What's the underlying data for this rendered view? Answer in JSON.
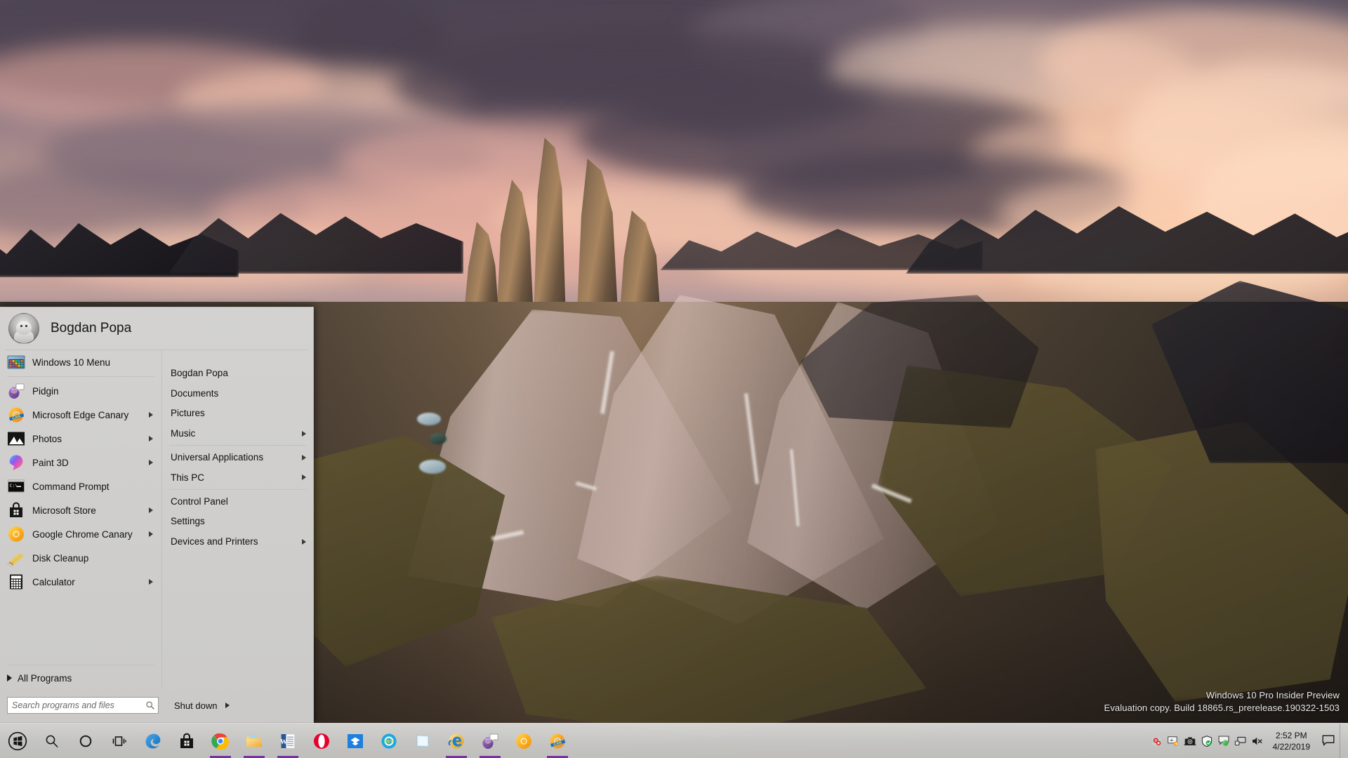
{
  "desktop": {
    "wallpaper_description": "Tre Cime di Lavaredo dolomite peaks at sunset with pink and orange clouds",
    "watermark": {
      "line1": "Windows 10 Pro Insider Preview",
      "line2": "Evaluation copy. Build 18865.rs_prerelease.190322-1503"
    }
  },
  "start_menu": {
    "user": {
      "name": "Bogdan Popa",
      "avatar_icon": "cat-avatar-icon"
    },
    "left_items": [
      {
        "label": "Windows 10 Menu",
        "icon": "windows-10-menu-icon",
        "has_submenu": false,
        "pinned": true
      },
      {
        "label": "Pidgin",
        "icon": "pidgin-icon",
        "has_submenu": false
      },
      {
        "label": "Microsoft Edge Canary",
        "icon": "edge-canary-icon",
        "has_submenu": true
      },
      {
        "label": "Photos",
        "icon": "photos-icon",
        "has_submenu": true
      },
      {
        "label": "Paint 3D",
        "icon": "paint-3d-icon",
        "has_submenu": true
      },
      {
        "label": "Command Prompt",
        "icon": "command-prompt-icon",
        "has_submenu": false
      },
      {
        "label": "Microsoft Store",
        "icon": "microsoft-store-icon",
        "has_submenu": true
      },
      {
        "label": "Google Chrome Canary",
        "icon": "chrome-canary-icon",
        "has_submenu": true
      },
      {
        "label": "Disk Cleanup",
        "icon": "disk-cleanup-icon",
        "has_submenu": false
      },
      {
        "label": "Calculator",
        "icon": "calculator-icon",
        "has_submenu": true
      }
    ],
    "all_programs_label": "All Programs",
    "right_items": [
      {
        "label": "Bogdan Popa",
        "has_submenu": false,
        "separator_after": false
      },
      {
        "label": "Documents",
        "has_submenu": false,
        "separator_after": false
      },
      {
        "label": "Pictures",
        "has_submenu": false,
        "separator_after": false
      },
      {
        "label": "Music",
        "has_submenu": true,
        "separator_after": true
      },
      {
        "label": "Universal Applications",
        "has_submenu": true,
        "separator_after": false
      },
      {
        "label": "This PC",
        "has_submenu": true,
        "separator_after": true
      },
      {
        "label": "Control Panel",
        "has_submenu": false,
        "separator_after": false
      },
      {
        "label": "Settings",
        "has_submenu": false,
        "separator_after": false
      },
      {
        "label": "Devices and Printers",
        "has_submenu": true,
        "separator_after": false
      }
    ],
    "search": {
      "placeholder": "Search programs and files",
      "value": "",
      "icon": "search-icon"
    },
    "shutdown": {
      "label": "Shut down",
      "has_submenu": true
    }
  },
  "taskbar": {
    "start_button": {
      "label": "Start",
      "icon": "windows-logo-icon"
    },
    "search_button": {
      "label": "Search",
      "icon": "search-icon"
    },
    "cortana_button": {
      "label": "Cortana",
      "icon": "cortana-circle-icon"
    },
    "task_view_button": {
      "label": "Task View",
      "icon": "task-view-icon"
    },
    "apps": [
      {
        "name": "Microsoft Edge",
        "icon": "edge-icon",
        "running": false
      },
      {
        "name": "Microsoft Store",
        "icon": "microsoft-store-icon",
        "running": false
      },
      {
        "name": "Google Chrome",
        "icon": "chrome-icon",
        "running": true
      },
      {
        "name": "File Explorer",
        "icon": "file-explorer-icon",
        "running": true
      },
      {
        "name": "Microsoft Word",
        "icon": "word-icon",
        "running": true
      },
      {
        "name": "Opera",
        "icon": "opera-icon",
        "running": false
      },
      {
        "name": "Dropbox",
        "icon": "dropbox-icon",
        "running": false
      },
      {
        "name": "Opera Developer",
        "icon": "opera-dev-icon",
        "running": false
      },
      {
        "name": "Sticky Notes",
        "icon": "sticky-notes-icon",
        "running": false
      },
      {
        "name": "Internet Explorer",
        "icon": "internet-explorer-icon",
        "running": true
      },
      {
        "name": "Pidgin",
        "icon": "pidgin-icon",
        "running": true
      },
      {
        "name": "Chrome Canary",
        "icon": "chrome-canary-icon",
        "running": false
      },
      {
        "name": "Microsoft Edge Canary",
        "icon": "edge-canary-icon",
        "running": true
      }
    ],
    "tray": [
      {
        "name": "Safety/Antivirus",
        "icon": "shield-eye-icon"
      },
      {
        "name": "Display settings",
        "icon": "display-icon"
      },
      {
        "name": "Screen capture",
        "icon": "camera-icon"
      },
      {
        "name": "Windows Security",
        "icon": "shield-check-icon"
      },
      {
        "name": "Status",
        "icon": "green-circle-icon"
      },
      {
        "name": "Network",
        "icon": "network-monitor-icon"
      },
      {
        "name": "Volume muted",
        "icon": "speaker-mute-icon"
      }
    ],
    "clock": {
      "time": "2:52 PM",
      "date": "4/22/2019"
    },
    "action_center": {
      "name": "Action Center",
      "icon": "notification-icon"
    }
  },
  "colors": {
    "menu_bg": "#d0cfcd",
    "taskbar_bg": "#d4d4d2",
    "running_underline": "#7a2fa0",
    "text": "#101010"
  }
}
